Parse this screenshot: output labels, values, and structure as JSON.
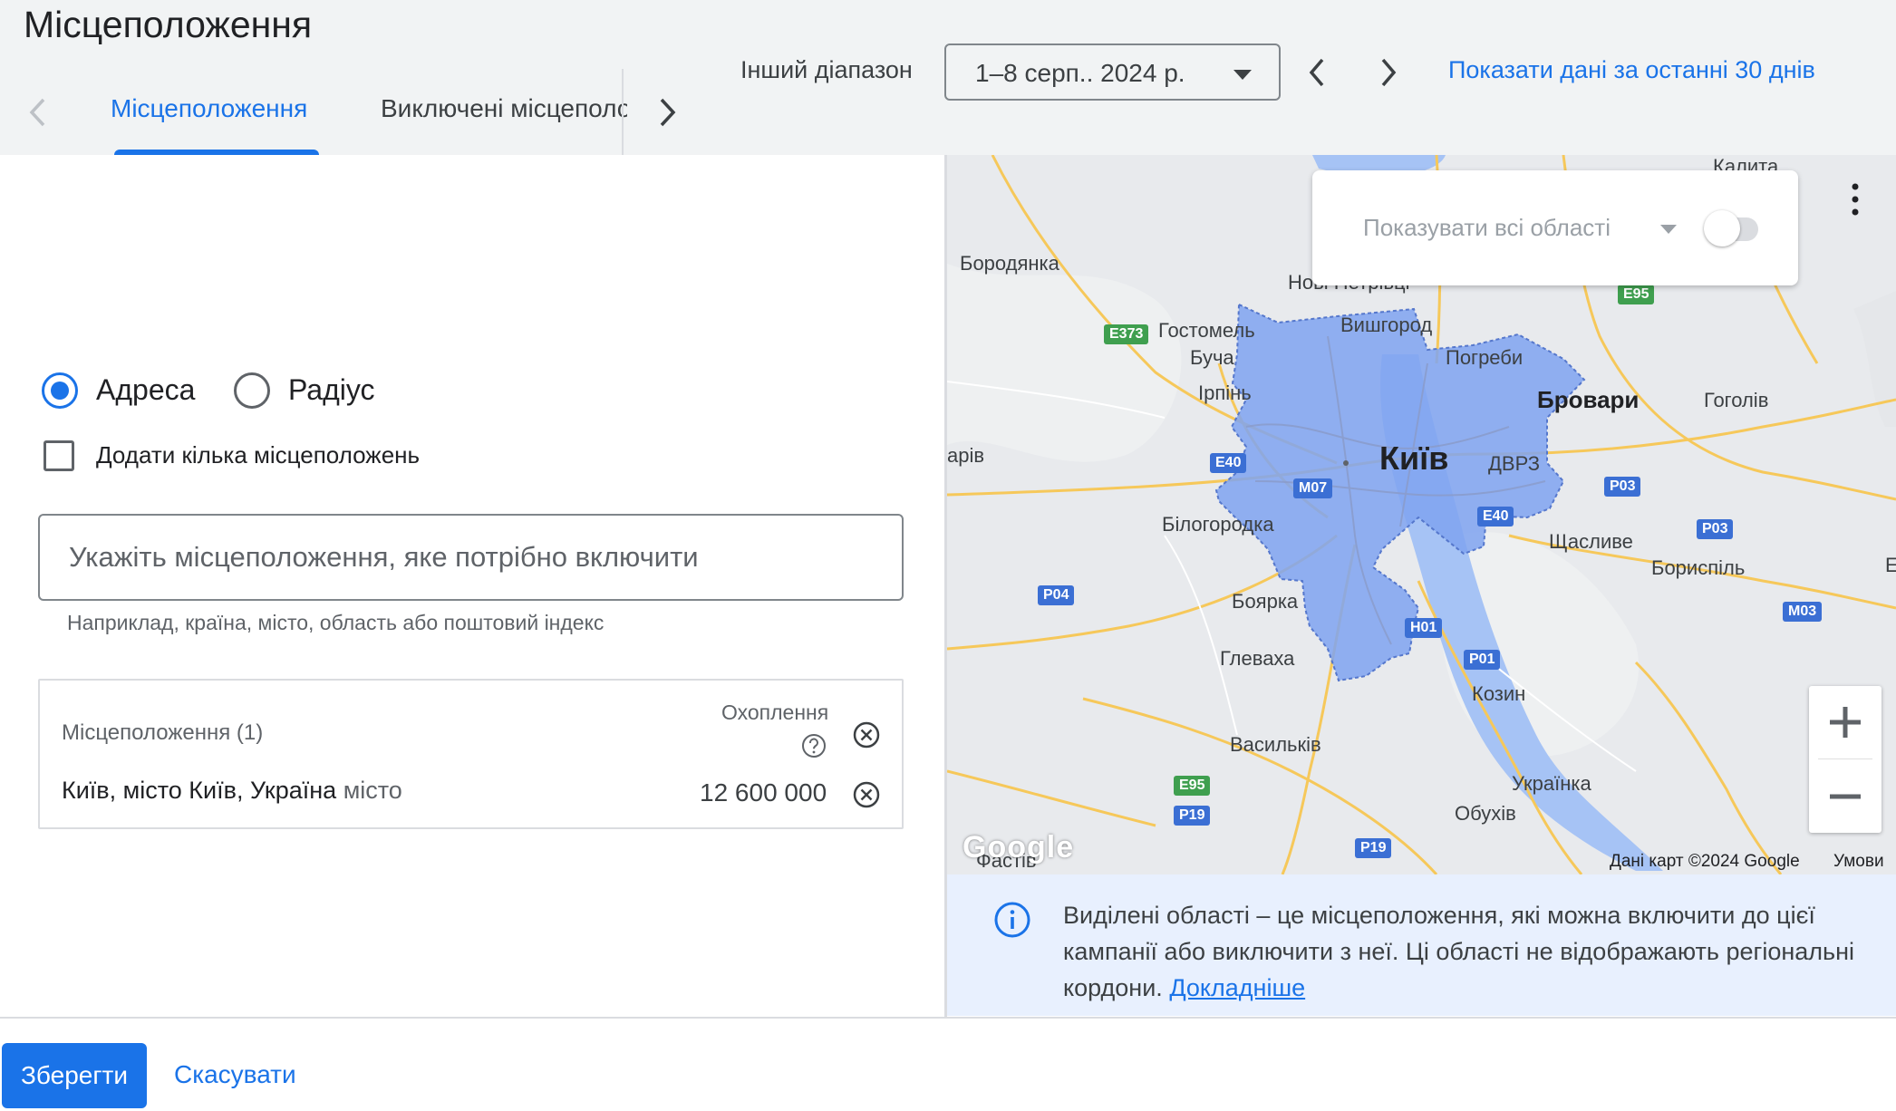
{
  "header": {
    "title": "Місцеположення",
    "tabs": [
      {
        "label": "Місцеположення",
        "active": true
      },
      {
        "label": "Виключені місцеположення",
        "active": false
      }
    ],
    "range_label": "Інший діапазон",
    "date_range": "1–8 серп.. 2024 р.",
    "last30_link": "Показати дані за останні 30 днів"
  },
  "form": {
    "radio_address": "Адреса",
    "radio_radius": "Радіус",
    "selected_mode": "Адреса",
    "multi_checkbox": "Додати кілька місцеположень",
    "input_placeholder": "Укажіть місцеположення, яке потрібно включити",
    "input_value": "",
    "hint": "Наприклад, країна, місто, область або поштовий індекс"
  },
  "locations": {
    "header": "Місцеположення (1)",
    "coverage_header": "Охоплення",
    "items": [
      {
        "name": "Київ, місто Київ, Україна",
        "type": "місто",
        "reach": "12 600 000"
      }
    ]
  },
  "map": {
    "areas_selector": "Показувати всі області",
    "areas_toggle": false,
    "zoom_in": "+",
    "zoom_out": "−",
    "google_logo": "Google",
    "attribution": "Дані карт ©2024 Google",
    "terms": "Умови",
    "labels": {
      "kyiv": "Київ",
      "brovary": "Бровари",
      "borodyanka": "Бородянка",
      "novi_petrivtsi": "Нові Петрівці",
      "vyshhorod": "Вишгород",
      "hostomel": "Гостомель",
      "bucha": "Буча",
      "irpin": "Ірпінь",
      "pohreby": "Погреби",
      "hoholiv": "Гоголів",
      "dvrz": "ДВРЗ",
      "shchaslyve": "Щасливе",
      "boryspil": "Бориспіль",
      "bilohorodka": "Білогородка",
      "boyarka": "Боярка",
      "hlevakha": "Глеваха",
      "vasylkiv": "Васильків",
      "kozyn": "Козин",
      "ukrainka": "Українка",
      "obukhiv": "Обухів",
      "fastiv": "Фастів",
      "makariv": "арів",
      "kalyta": "Калита",
      "edge_e": "Е"
    },
    "shields": {
      "e95_top": "E95",
      "e373": "E373",
      "e40_w": "E40",
      "m07": "M07",
      "e40_c": "E40",
      "p03_a": "P03",
      "p03_b": "P03",
      "p04": "P04",
      "m03": "M03",
      "h01": "H01",
      "p01": "P01",
      "e95_bottom": "E95",
      "p19_a": "P19",
      "p19_b": "P19"
    }
  },
  "info": {
    "text": "Виділені області – це місцеположення, які можна включити до цієї кампанії або виключити з неї. Ці області не відображають регіональні кордони.",
    "link": "Докладніше"
  },
  "footer": {
    "save": "Зберегти",
    "cancel": "Скасувати"
  },
  "colors": {
    "accent": "#1a73e8",
    "highlight_area": "#7fa3f0",
    "water": "#a6c3f5",
    "road": "#f6c85a"
  }
}
